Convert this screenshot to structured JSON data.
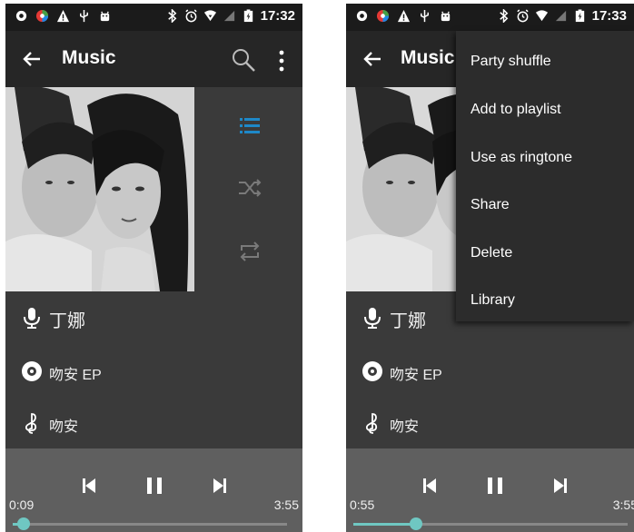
{
  "left": {
    "status": {
      "time": "17:32"
    },
    "toolbar": {
      "title": "Music"
    },
    "artist": "丁娜",
    "album": "吻安 EP",
    "song": "吻安",
    "player": {
      "elapsed": "0:09",
      "duration": "3:55",
      "progress": 0.04
    }
  },
  "right": {
    "status": {
      "time": "17:33"
    },
    "toolbar": {
      "title": "Music"
    },
    "artist": "丁娜",
    "album": "吻安 EP",
    "song": "吻安",
    "player": {
      "elapsed": "0:55",
      "duration": "3:55",
      "progress": 0.23
    },
    "menu": {
      "items": [
        "Party shuffle",
        "Add to playlist",
        "Use as ringtone",
        "Share",
        "Delete",
        "Library"
      ]
    }
  },
  "colors": {
    "accent": "#6fc7c2",
    "icon_blue": "#1e88c8",
    "toolbar": "#262626",
    "panel": "#3a3a3a"
  }
}
